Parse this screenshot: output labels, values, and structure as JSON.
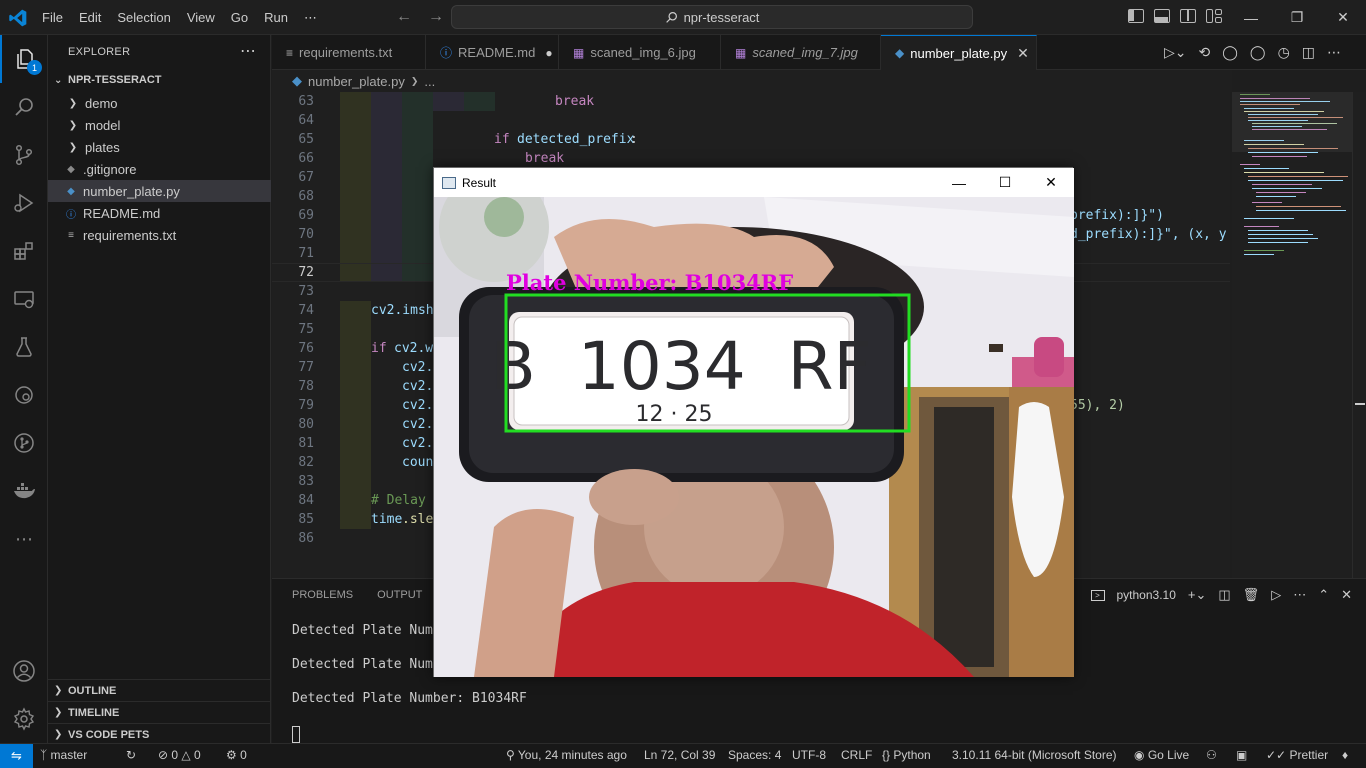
{
  "titlebar": {
    "menu": [
      "File",
      "Edit",
      "Selection",
      "View",
      "Go",
      "Run",
      "⋯"
    ],
    "search_text": "npr-tesseract"
  },
  "activity": {
    "explorer_badge": "1"
  },
  "sidebar": {
    "title": "EXPLORER",
    "root": "NPR-TESSERACT",
    "items": [
      {
        "label": "demo",
        "kind": "folder"
      },
      {
        "label": "model",
        "kind": "folder"
      },
      {
        "label": "plates",
        "kind": "folder"
      },
      {
        "label": ".gitignore",
        "kind": "file"
      },
      {
        "label": "number_plate.py",
        "kind": "python"
      },
      {
        "label": "README.md",
        "kind": "info"
      },
      {
        "label": "requirements.txt",
        "kind": "file"
      }
    ],
    "sections": [
      "OUTLINE",
      "TIMELINE",
      "VS CODE PETS"
    ]
  },
  "tabs": [
    {
      "label": "requirements.txt"
    },
    {
      "label": "README.md"
    },
    {
      "label": "scaned_img_6.jpg"
    },
    {
      "label": "scaned_img_7.jpg"
    },
    {
      "label": "number_plate.py"
    }
  ],
  "breadcrumb": {
    "file": "number_plate.py",
    "more": "..."
  },
  "editor": {
    "line_numbers": [
      "63",
      "64",
      "65",
      "66",
      "67",
      "68",
      "69",
      "70",
      "71",
      "72",
      "73",
      "74",
      "75",
      "76",
      "77",
      "78",
      "79",
      "80",
      "81",
      "82",
      "83",
      "84",
      "85",
      "86"
    ],
    "code": {
      "l63": "break",
      "l65a": "if",
      "l65b": "detected_prefix",
      "l65c": ":",
      "l66": "break",
      "l69": "prefix):]}\")",
      "l70a": "d_prefix):]}\", (x, y",
      "l74": "cv2.imsh",
      "l76a": "if",
      "l76b": "cv2.w",
      "l77": "cv2.",
      "l78": "cv2.",
      "l79": "cv2.",
      "l79r": "55), 2)",
      "l80": "cv2.",
      "l81": "cv2.",
      "l82": "coun",
      "l84": "# Delay",
      "l85a": "time",
      "l85b": ".sle"
    }
  },
  "panel": {
    "tabs": [
      "PROBLEMS",
      "OUTPUT"
    ],
    "terminal_name": "python3.10",
    "lines": [
      "Detected Plate Numbe",
      "Detected Plate Numbe",
      "Detected Plate Number: B1034RF"
    ]
  },
  "result_window": {
    "title": "Result",
    "overlay_text": "Plate Number: B1034RF",
    "plate_main": "B  1034  RF",
    "plate_sub": "12 · 25"
  },
  "statusbar": {
    "branch": "master",
    "errors": "0",
    "warnings": "0",
    "ports": "0",
    "blame": "You, 24 minutes ago",
    "position": "Ln 72, Col 39",
    "spaces": "Spaces: 4",
    "encoding": "UTF-8",
    "eol": "CRLF",
    "language": "Python",
    "interpreter": "3.10.11 64-bit (Microsoft Store)",
    "golive": "Go Live",
    "prettier": "Prettier"
  },
  "colors": {
    "accent": "#0078d4",
    "overlay_magenta": "#e000e0",
    "box_green": "#22dd22",
    "editor_bg": "#1f1f1f"
  }
}
